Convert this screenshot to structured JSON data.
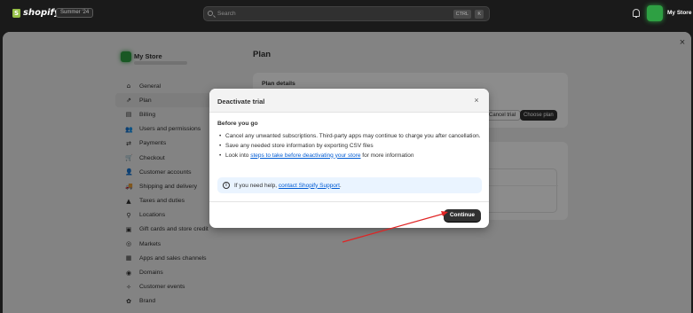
{
  "topbar": {
    "logo_text": "shopify",
    "edition_badge": "Summer '24",
    "search_placeholder": "Search",
    "shortcut_ctrl": "CTRL",
    "shortcut_k": "K",
    "store_name": "My Store"
  },
  "settings": {
    "close_glyph": "×",
    "store_title": "My Store",
    "nav": [
      {
        "label": "General",
        "icon": "store-icon",
        "glyph": "⌂"
      },
      {
        "label": "Plan",
        "icon": "plan-icon",
        "glyph": "⇗",
        "active": true
      },
      {
        "label": "Billing",
        "icon": "billing-icon",
        "glyph": "▤"
      },
      {
        "label": "Users and permissions",
        "icon": "users-icon",
        "glyph": "👥"
      },
      {
        "label": "Payments",
        "icon": "payments-icon",
        "glyph": "⇄"
      },
      {
        "label": "Checkout",
        "icon": "cart-icon",
        "glyph": "🛒"
      },
      {
        "label": "Customer accounts",
        "icon": "person-icon",
        "glyph": "👤"
      },
      {
        "label": "Shipping and delivery",
        "icon": "truck-icon",
        "glyph": "🚚"
      },
      {
        "label": "Taxes and duties",
        "icon": "tax-icon",
        "glyph": "▲"
      },
      {
        "label": "Locations",
        "icon": "location-icon",
        "glyph": "⚲"
      },
      {
        "label": "Gift cards and store credit",
        "icon": "gift-icon",
        "glyph": "▣"
      },
      {
        "label": "Markets",
        "icon": "globe-icon",
        "glyph": "◎"
      },
      {
        "label": "Apps and sales channels",
        "icon": "apps-icon",
        "glyph": "▦"
      },
      {
        "label": "Domains",
        "icon": "domain-icon",
        "glyph": "◉"
      },
      {
        "label": "Customer events",
        "icon": "events-icon",
        "glyph": "✧"
      },
      {
        "label": "Brand",
        "icon": "brand-icon",
        "glyph": "✿"
      }
    ],
    "page_title": "Plan",
    "plan_details_title": "Plan details",
    "cancel_trial_label": "Cancel trial",
    "choose_plan_label": "Choose plan"
  },
  "modal": {
    "title": "Deactivate trial",
    "close_glyph": "×",
    "before_title": "Before you go",
    "bullet_1": "Cancel any unwanted subscriptions. Third-party apps may continue to charge you after cancellation.",
    "bullet_2": "Save any needed store information by exporting CSV files",
    "bullet_3_prefix": "Look into ",
    "bullet_3_link": "steps to take before deactivating your store",
    "bullet_3_suffix": " for more information",
    "info_prefix": "If you need help, ",
    "info_link": "contact Shopify Support",
    "info_suffix": ".",
    "continue_label": "Continue"
  },
  "colors": {
    "annotation_arrow": "#e02424",
    "primary_button": "#303030",
    "link": "#005bd3"
  }
}
